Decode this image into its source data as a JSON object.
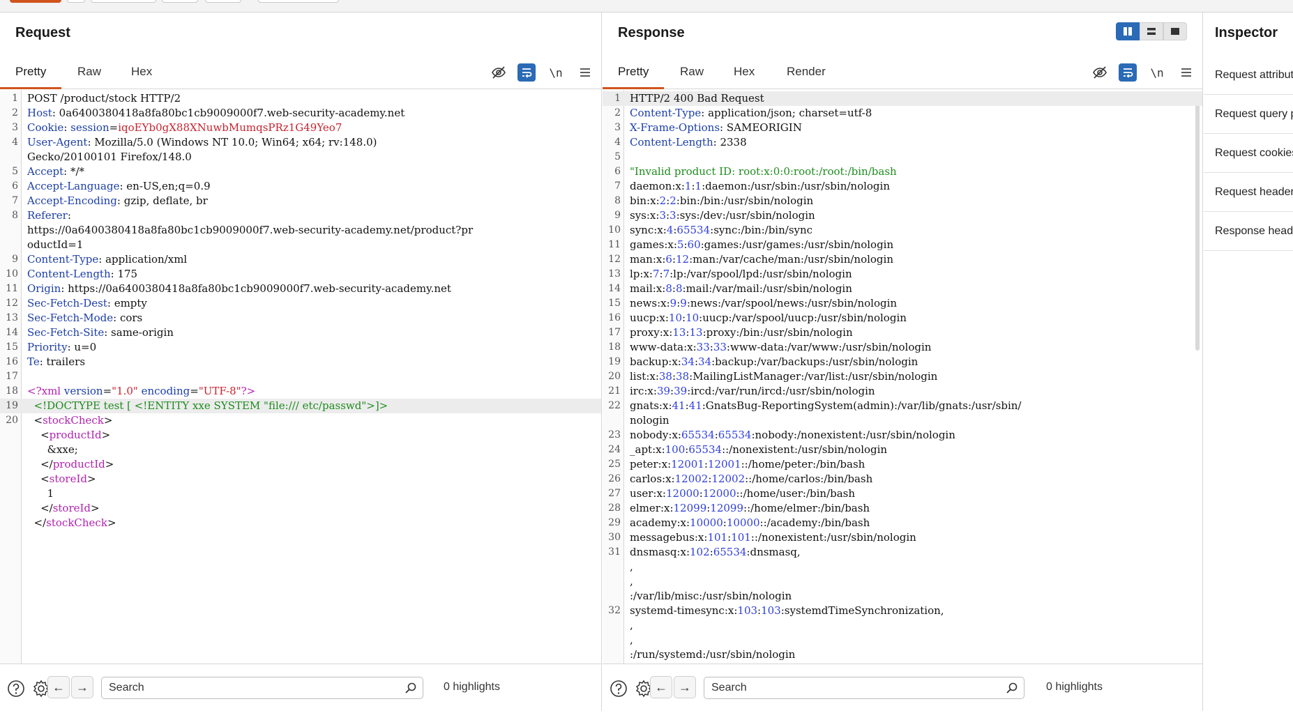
{
  "request": {
    "title": "Request",
    "tabs": [
      "Pretty",
      "Raw",
      "Hex"
    ],
    "footer": {
      "search_placeholder": "Search",
      "highlights": "0 highlights"
    }
  },
  "response": {
    "title": "Response",
    "tabs": [
      "Pretty",
      "Raw",
      "Hex",
      "Render"
    ],
    "footer": {
      "search_placeholder": "Search",
      "highlights": "0 highlights"
    }
  },
  "inspector": {
    "title": "Inspector",
    "items": [
      "Request attributes",
      "Request query parameters",
      "Request cookies",
      "Request headers",
      "Response headers"
    ]
  },
  "tools": {
    "newline_label": "\\n"
  },
  "colors": {
    "accent": "#d0541d",
    "toggle_active": "#2a6ab6",
    "header_key": "#1c3ea8",
    "xml_tag": "#b222b2",
    "string": "#c7232f",
    "body_green": "#1e8c1e",
    "number_blue": "#2f3fdd"
  }
}
